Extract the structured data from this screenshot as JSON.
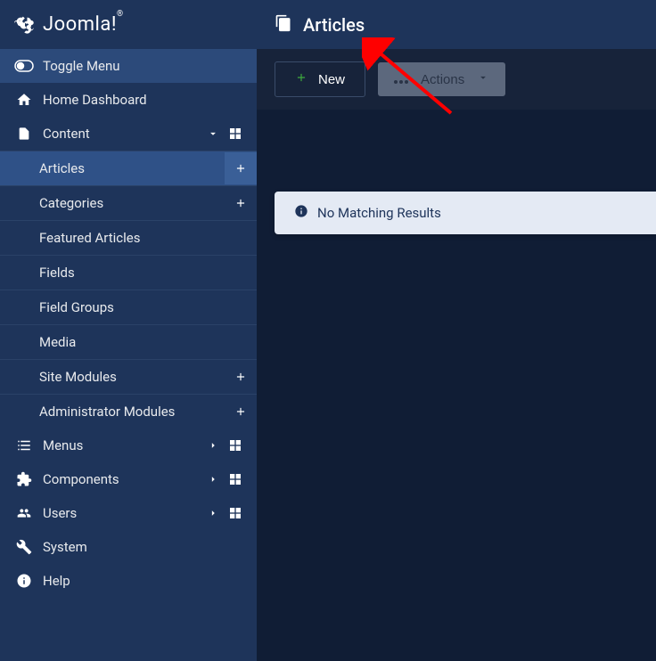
{
  "logo": {
    "text": "Joomla!"
  },
  "header": {
    "title": "Articles"
  },
  "toolbar": {
    "new_label": "New",
    "actions_label": "Actions"
  },
  "sidebar": {
    "toggle_label": "Toggle Menu",
    "home_label": "Home Dashboard",
    "content": {
      "label": "Content",
      "items": [
        {
          "label": "Articles",
          "has_plus": true,
          "active": true
        },
        {
          "label": "Categories",
          "has_plus": true
        },
        {
          "label": "Featured Articles"
        },
        {
          "label": "Fields"
        },
        {
          "label": "Field Groups"
        },
        {
          "label": "Media"
        },
        {
          "label": "Site Modules",
          "has_plus": true
        },
        {
          "label": "Administrator Modules",
          "has_plus": true
        }
      ]
    },
    "menus_label": "Menus",
    "components_label": "Components",
    "users_label": "Users",
    "system_label": "System",
    "help_label": "Help"
  },
  "alert": {
    "text": "No Matching Results"
  }
}
